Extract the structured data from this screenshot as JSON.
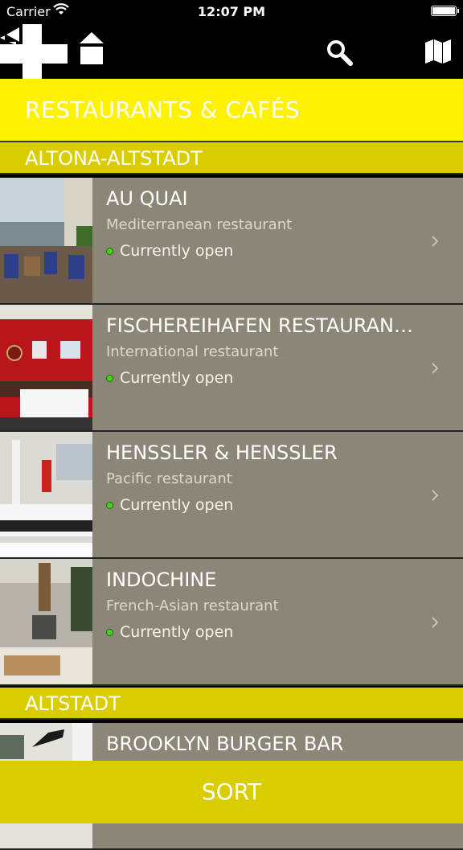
{
  "status_bar": {
    "carrier": "Carrier",
    "time": "12:07 PM"
  },
  "nav": {
    "title": "RESTAURANTS & CAFÉS"
  },
  "sections": [
    {
      "header": "ALTONA-ALTSTADT",
      "items": [
        {
          "name": "AU QUAI",
          "category": "Mediterranean restaurant",
          "status": "Currently open"
        },
        {
          "name": "FISCHEREIHAFEN RESTAURAN…",
          "category": "International restaurant",
          "status": "Currently open"
        },
        {
          "name": "HENSSLER & HENSSLER",
          "category": "Pacific restaurant",
          "status": "Currently open"
        },
        {
          "name": "INDOCHINE",
          "category": "French-Asian restaurant",
          "status": "Currently open"
        }
      ]
    },
    {
      "header": "ALTSTADT",
      "items": [
        {
          "name": "BROOKLYN BURGER BAR"
        }
      ]
    }
  ],
  "sort": {
    "label": "SORT"
  },
  "colors": {
    "accent_yellow": "#fff200",
    "section_yellow": "#d9cd00",
    "row_bg": "#8c8678",
    "open_dot": "#48d11e"
  }
}
